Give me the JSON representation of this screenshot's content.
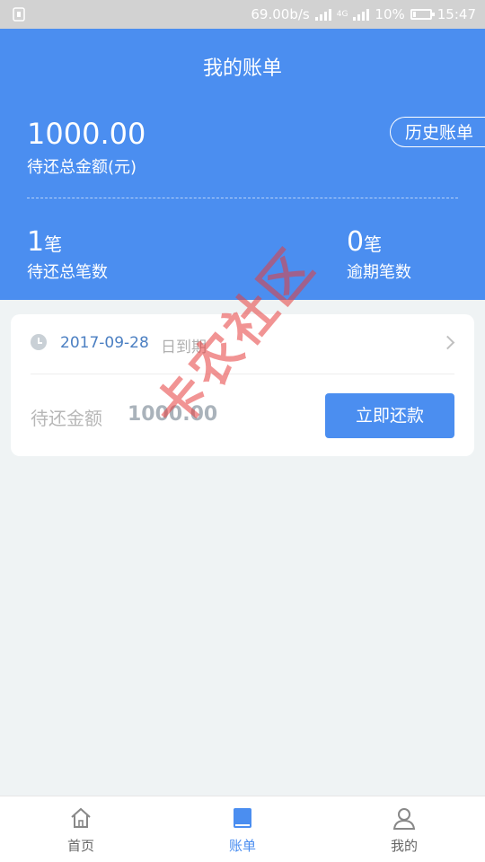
{
  "status_bar": {
    "speed": "69.00b/s",
    "network": "4G",
    "battery": "10%",
    "time": "15:47"
  },
  "header": {
    "title": "我的账单",
    "history_button": "历史账单",
    "total_amount": "1000.00",
    "total_amount_label": "待还总金额(元)",
    "pending_count": "1",
    "pending_unit": "笔",
    "pending_label": "待还总笔数",
    "overdue_count": "0",
    "overdue_unit": "笔",
    "overdue_label": "逾期笔数"
  },
  "bill_card": {
    "due_date": "2017-09-28",
    "due_suffix": "日到期",
    "pay_label": "待还金额",
    "pay_amount": "1000.00",
    "pay_button": "立即还款"
  },
  "watermark": "卡农社区",
  "tabs": [
    {
      "label": "首页",
      "icon": "home-icon",
      "active": false
    },
    {
      "label": "账单",
      "icon": "bill-book-icon",
      "active": true
    },
    {
      "label": "我的",
      "icon": "user-icon",
      "active": false
    }
  ],
  "colors": {
    "primary": "#4b8ef0",
    "background": "#eff3f4"
  }
}
